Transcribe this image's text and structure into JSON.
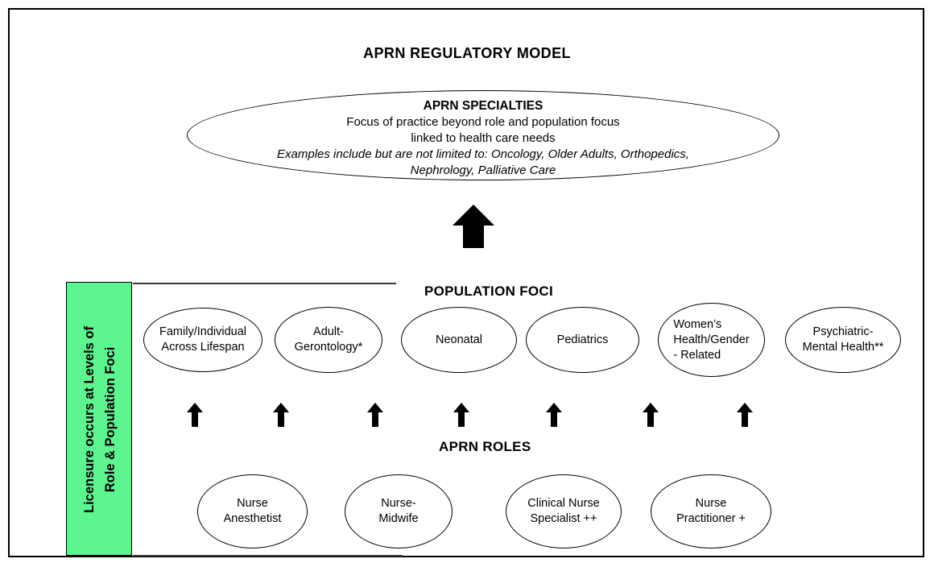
{
  "title": "APRN REGULATORY MODEL",
  "specialties": {
    "heading": "APRN SPECIALTIES",
    "line1": "Focus of practice beyond role and population focus",
    "line2": "linked to health care needs",
    "line3": "Examples include but are not limited to: Oncology, Older Adults, Orthopedics,",
    "line4": "Nephrology, Palliative Care"
  },
  "licensure_band": {
    "line1": "Licensure occurs at Levels of",
    "line2": "Role & Population Foci",
    "color": "#5df58f"
  },
  "population_foci": {
    "heading": "POPULATION FOCI",
    "nodes": [
      {
        "label": "Family/Individual\nAcross Lifespan",
        "align": "center"
      },
      {
        "label": "Adult-\nGerontology*",
        "align": "center"
      },
      {
        "label": "Neonatal",
        "align": "center"
      },
      {
        "label": "Pediatrics",
        "align": "center"
      },
      {
        "label": "Women’s\nHealth/Gender\n- Related",
        "align": "left"
      },
      {
        "label": "Psychiatric-\nMental Health**",
        "align": "center"
      }
    ]
  },
  "aprn_roles": {
    "heading": "APRN ROLES",
    "nodes": [
      {
        "label": "Nurse\nAnesthetist"
      },
      {
        "label": "Nurse-\nMidwife"
      },
      {
        "label": "Clinical Nurse\nSpecialist ++"
      },
      {
        "label": "Nurse\nPractitioner +"
      }
    ]
  },
  "arrows": {
    "central": "up-arrow-large",
    "role_to_population_count": 7
  }
}
